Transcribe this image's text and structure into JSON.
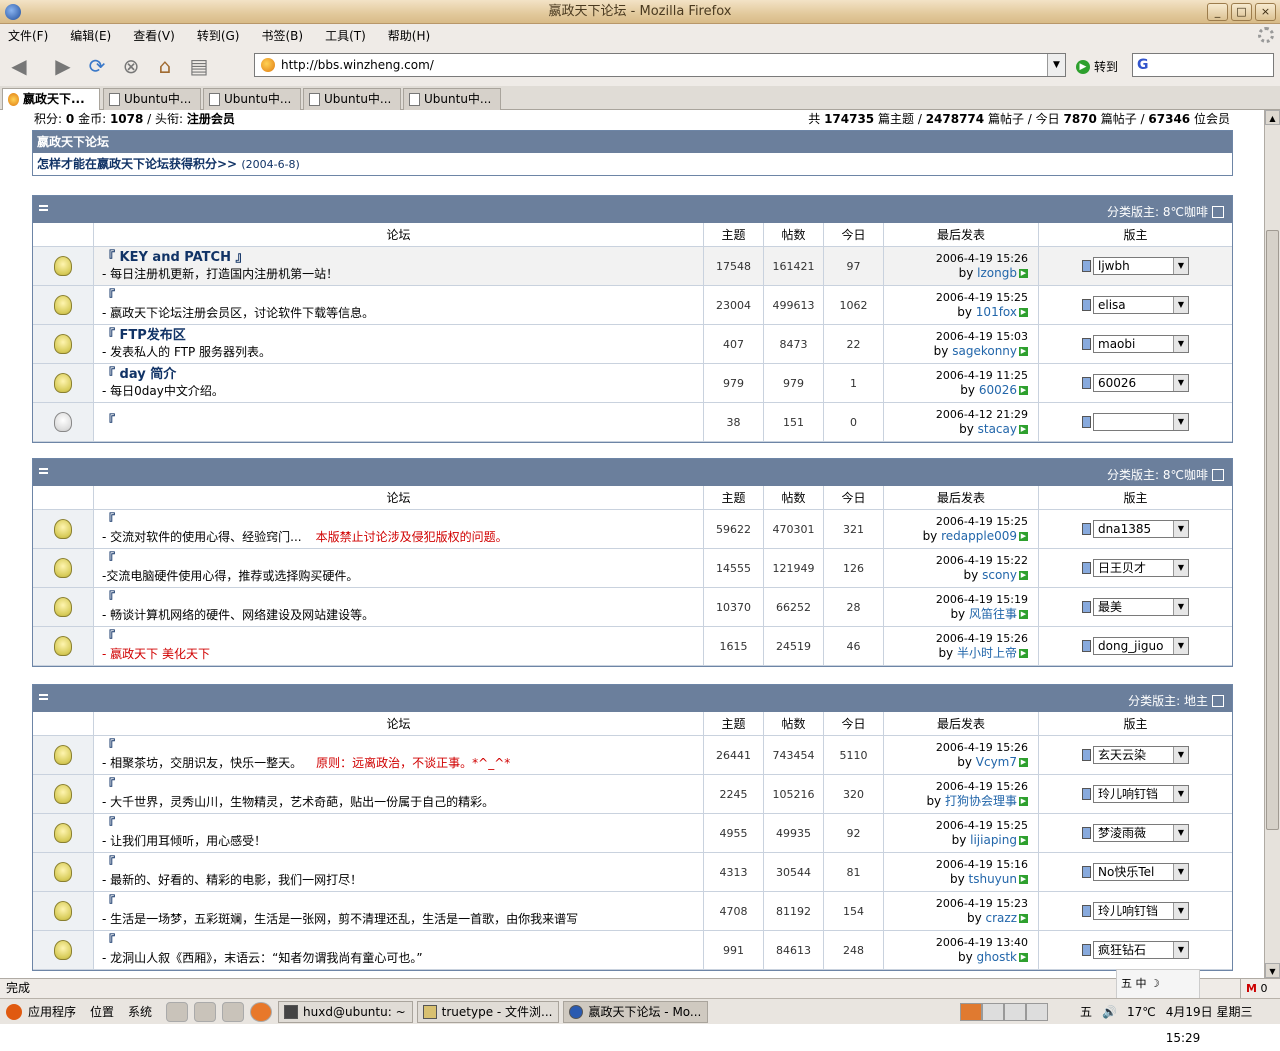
{
  "window": {
    "title": "嬴政天下论坛 - Mozilla Firefox",
    "buttons": [
      "_",
      "□",
      "×"
    ]
  },
  "menu": [
    "文件(F)",
    "编辑(E)",
    "查看(V)",
    "转到(G)",
    "书签(B)",
    "工具(T)",
    "帮助(H)"
  ],
  "nav": {
    "url": "http://bbs.winzheng.com/",
    "go_label": "转到",
    "search_logo": "G"
  },
  "tabs": [
    "嬴政天下...",
    "Ubuntu中...",
    "Ubuntu中...",
    "Ubuntu中...",
    "Ubuntu中..."
  ],
  "info": {
    "left_label1": "积分:",
    "points": "0",
    "left_label2": "金币:",
    "coins": "1078",
    "left_label3": "/ 头衔:",
    "rank": "注册会员",
    "right_prefix": "共",
    "topics": "174735",
    "topics_unit": "篇主题 /",
    "posts": "2478774",
    "posts_unit": "篇帖子 / 今日",
    "today": "7870",
    "today_unit": "篇帖子 /",
    "members": "67346",
    "members_unit": "位会员"
  },
  "announce": {
    "title": "嬴政天下论坛",
    "link": "怎样才能在嬴政天下论坛获得积分>>",
    "date": "(2004-6-8)"
  },
  "columns": [
    "论坛",
    "主题",
    "帖数",
    "今日",
    "最后发表",
    "版主"
  ],
  "sections": [
    {
      "moderator": "分类版主: 8℃咖啡",
      "rows": [
        {
          "name": "『 KEY and PATCH 』",
          "desc": "- 每日注册机更新，打造国内注册机第一站！",
          "warn": "",
          "topics": "17548",
          "posts": "161421",
          "today": "97",
          "time": "2006-4-19 15:26",
          "by": "lzongb",
          "mod": "ljwbh",
          "bulb": "on",
          "hl": true
        },
        {
          "name": "『",
          "desc": "- 嬴政天下论坛注册会员区，讨论软件下载等信息。",
          "warn": "",
          "topics": "23004",
          "posts": "499613",
          "today": "1062",
          "time": "2006-4-19 15:25",
          "by": "101fox",
          "mod": "elisa",
          "bulb": "on"
        },
        {
          "name": "『 FTP发布区",
          "desc": "- 发表私人的 FTP 服务器列表。",
          "warn": "",
          "topics": "407",
          "posts": "8473",
          "today": "22",
          "time": "2006-4-19 15:03",
          "by": "sagekonny",
          "mod": "maobi",
          "bulb": "on"
        },
        {
          "name": "『 day 简介",
          "desc": "- 每日0day中文介绍。",
          "warn": "",
          "topics": "979",
          "posts": "979",
          "today": "1",
          "time": "2006-4-19 11:25",
          "by": "60026",
          "mod": "60026",
          "bulb": "on"
        },
        {
          "name": "『",
          "desc": "",
          "warn": "",
          "topics": "38",
          "posts": "151",
          "today": "0",
          "time": "2006-4-12 21:29",
          "by": "stacay",
          "mod": "",
          "bulb": "off"
        }
      ]
    },
    {
      "moderator": "分类版主: 8℃咖啡",
      "rows": [
        {
          "name": "『",
          "desc": "- 交流对软件的使用心得、经验窍门...",
          "warn": "本版禁止讨论涉及侵犯版权的问题。",
          "topics": "59622",
          "posts": "470301",
          "today": "321",
          "time": "2006-4-19 15:25",
          "by": "redapple009",
          "mod": "dna1385",
          "bulb": "on"
        },
        {
          "name": "『",
          "desc": "-交流电脑硬件使用心得，推荐或选择购买硬件。",
          "warn": "",
          "topics": "14555",
          "posts": "121949",
          "today": "126",
          "time": "2006-4-19 15:22",
          "by": "scony",
          "mod": "日王贝才",
          "bulb": "on"
        },
        {
          "name": "『",
          "desc": "- 畅谈计算机网络的硬件、网络建设及网站建设等。",
          "warn": "",
          "topics": "10370",
          "posts": "66252",
          "today": "28",
          "time": "2006-4-19 15:19",
          "by": "风笛往事",
          "mod": "最美",
          "bulb": "on"
        },
        {
          "name": "『",
          "desc": "",
          "desc_red": "- 嬴政天下 美化天下",
          "warn": "",
          "topics": "1615",
          "posts": "24519",
          "today": "46",
          "time": "2006-4-19 15:26",
          "by": "半小时上帝",
          "mod": "dong_jiguo",
          "bulb": "on"
        }
      ]
    },
    {
      "moderator": "分类版主: 地主",
      "rows": [
        {
          "name": "『",
          "desc": "- 相聚茶坊，交朋识友，快乐一整天。",
          "warn": "原则：远离政治，不谈正事。*^_^*",
          "topics": "26441",
          "posts": "743454",
          "today": "5110",
          "time": "2006-4-19 15:26",
          "by": "Vcym7",
          "mod": "玄天云染",
          "bulb": "on"
        },
        {
          "name": "『",
          "desc": "- 大千世界，灵秀山川，生物精灵，艺术奇葩，贴出一份属于自己的精彩。",
          "warn": "",
          "topics": "2245",
          "posts": "105216",
          "today": "320",
          "time": "2006-4-19 15:26",
          "by": "打狗协会理事",
          "mod": "玲儿响钉铛",
          "bulb": "on"
        },
        {
          "name": "『",
          "desc": "- 让我们用耳倾听，用心感受！",
          "warn": "",
          "topics": "4955",
          "posts": "49935",
          "today": "92",
          "time": "2006-4-19 15:25",
          "by": "lijiaping",
          "mod": "梦淩雨薇",
          "bulb": "on"
        },
        {
          "name": "『",
          "desc": "- 最新的、好看的、精彩的电影，我们一网打尽！",
          "warn": "",
          "topics": "4313",
          "posts": "30544",
          "today": "81",
          "time": "2006-4-19 15:16",
          "by": "tshuyun",
          "mod": "No快乐Tel",
          "bulb": "on"
        },
        {
          "name": "『",
          "desc": "- 生活是一场梦，五彩斑斓，生活是一张网，剪不清理还乱，生活是一首歌，由你我来谱写",
          "warn": "",
          "topics": "4708",
          "posts": "81192",
          "today": "154",
          "time": "2006-4-19 15:23",
          "by": "crazz",
          "mod": "玲儿响钉铛",
          "bulb": "on"
        },
        {
          "name": "『",
          "desc": "- 龙洞山人叙《西厢》，末语云：“知者勿谓我尚有童心可也。”",
          "warn": "",
          "topics": "991",
          "posts": "84613",
          "today": "248",
          "time": "2006-4-19 13:40",
          "by": "ghostk",
          "mod": "疯狂钻石",
          "bulb": "on"
        }
      ]
    }
  ],
  "status": {
    "text": "完成",
    "ime": "五 中 ☽",
    "mail_count": "0"
  },
  "taskbar": {
    "menus": [
      "应用程序",
      "位置",
      "系统"
    ],
    "windows": [
      "huxd@ubuntu: ~",
      "truetype - 文件浏...",
      "嬴政天下论坛 - Mo..."
    ],
    "tray": [
      "五",
      "🔊",
      "17℃",
      "4月19日 星期三 15:29"
    ]
  }
}
